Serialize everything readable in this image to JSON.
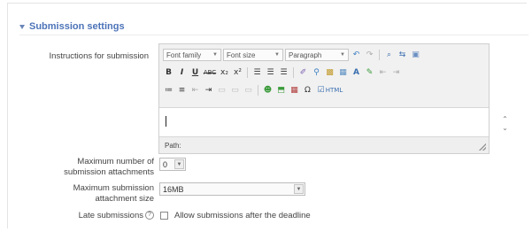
{
  "section": {
    "title": "Submission settings"
  },
  "instructions": {
    "label": "Instructions for submission",
    "toolbar": {
      "font_family": "Font family",
      "font_size": "Font size",
      "paragraph": "Paragraph",
      "bold": "B",
      "italic": "I",
      "underline": "U",
      "strike": "ABC",
      "subscript": "x₂",
      "superscript": "x²"
    },
    "path_label": "Path:"
  },
  "attachments": {
    "label_line1": "Maximum number of",
    "label_line2": "submission attachments",
    "value": "0"
  },
  "size": {
    "label_line1": "Maximum submission",
    "label_line2": "attachment size",
    "value": "16MB"
  },
  "late": {
    "label": "Late submissions",
    "help": "?",
    "checkbox_label": "Allow submissions after the deadline"
  }
}
